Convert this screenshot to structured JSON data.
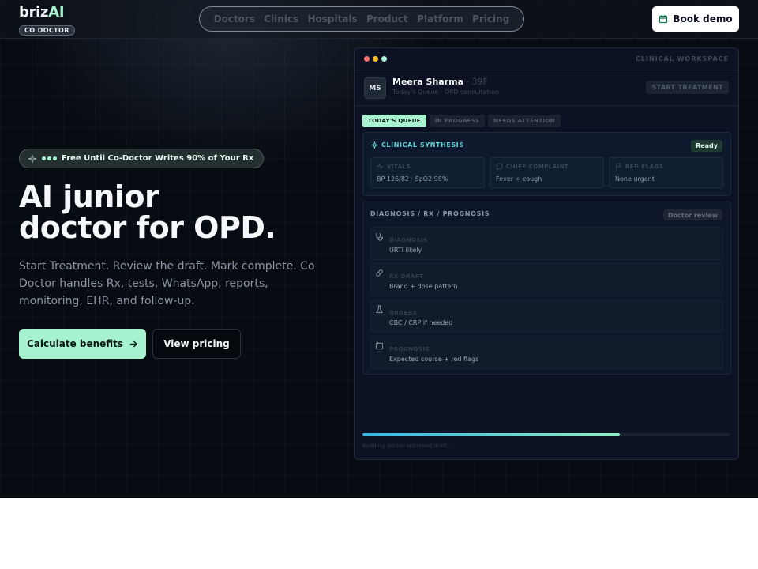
{
  "header": {
    "brand_name": "briz",
    "brand_name_accent": "AI",
    "brand_badge": "CO DOCTOR",
    "nav": [
      "Doctors",
      "Clinics",
      "Hospitals",
      "Product",
      "Platform",
      "Pricing"
    ],
    "book_demo": "Book demo"
  },
  "hero": {
    "pill_text": "Free Until Co-Doctor Writes 90% of Your Rx",
    "headline_line1": "AI junior",
    "headline_line2": "doctor for OPD.",
    "subtext": "Start Treatment. Review the draft. Mark complete. Co Doctor handles Rx, tests, WhatsApp, reports, monitoring, EHR, and follow-up.",
    "primary_cta": "Calculate benefits",
    "secondary_cta": "View pricing"
  },
  "workspace": {
    "label": "CLINICAL WORKSPACE",
    "window_dot_colors": [
      "#f87171",
      "#fbbf24",
      "#a7f3d0"
    ],
    "patient": {
      "initials": "MS",
      "name": "Meera Sharma",
      "age_sep": " · ",
      "age": "39F",
      "meta": "Today's Queue · OPD consultation"
    },
    "start_button": "START TREATMENT",
    "tabs": [
      "TODAY'S QUEUE",
      "IN PROGRESS",
      "NEEDS ATTENTION"
    ],
    "active_tab": 0,
    "synthesis": {
      "title": "CLINICAL SYNTHESIS",
      "status": "Ready",
      "cards": [
        {
          "label": "VITALS",
          "value": "BP 126/82 · SpO2 98%",
          "icon": "pulse-icon"
        },
        {
          "label": "CHIEF COMPLAINT",
          "value": "Fever + cough",
          "icon": "chat-icon"
        },
        {
          "label": "RED FLAGS",
          "value": "None urgent",
          "icon": "flag-icon"
        }
      ]
    },
    "diagnosis": {
      "title": "DIAGNOSIS / RX / PROGNOSIS",
      "badge": "Doctor review",
      "rows": [
        {
          "label": "DIAGNOSIS",
          "value": "URTI likely",
          "icon": "stethoscope-icon"
        },
        {
          "label": "RX DRAFT",
          "value": "Brand + dose pattern",
          "icon": "pill-icon"
        },
        {
          "label": "ORDERS",
          "value": "CBC / CRP if needed",
          "icon": "flask-icon"
        },
        {
          "label": "PROGNOSIS",
          "value": "Expected course + red flags",
          "icon": "calendar-icon"
        }
      ]
    },
    "progress": 0.7,
    "status_text": "Building doctor-approved draft..."
  }
}
